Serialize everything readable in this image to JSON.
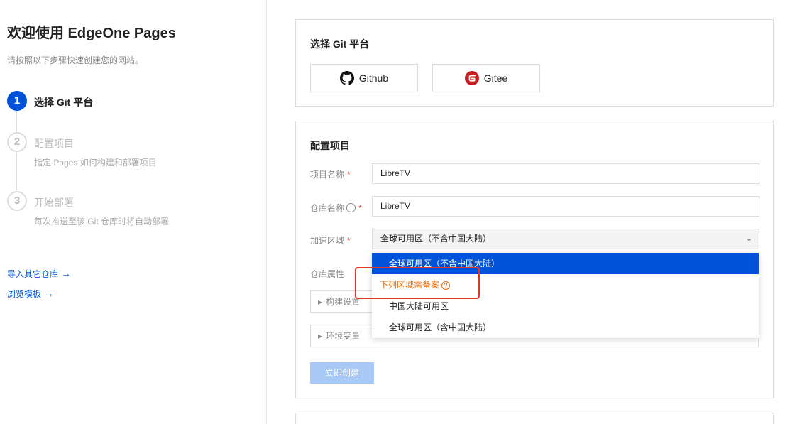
{
  "sidebar": {
    "title": "欢迎使用 EdgeOne Pages",
    "subtitle": "请按照以下步骤快速创建您的网站。",
    "steps": [
      {
        "num": "1",
        "title": "选择 Git 平台",
        "desc": ""
      },
      {
        "num": "2",
        "title": "配置项目",
        "desc": "指定 Pages 如何构建和部署项目"
      },
      {
        "num": "3",
        "title": "开始部署",
        "desc": "每次推送至该 Git 仓库时将自动部署"
      }
    ],
    "links": [
      {
        "label": "导入其它仓库",
        "arrow": "→"
      },
      {
        "label": "浏览模板",
        "arrow": "→"
      }
    ]
  },
  "git_platform": {
    "title": "选择 Git 平台",
    "options": [
      {
        "label": "Github",
        "icon": "github-icon"
      },
      {
        "label": "Gitee",
        "icon": "gitee-icon"
      }
    ]
  },
  "config": {
    "title": "配置项目",
    "project_name_label": "项目名称",
    "project_name_value": "LibreTV",
    "repo_name_label": "仓库名称",
    "repo_name_value": "LibreTV",
    "region_label": "加速区域",
    "region_value": "全球可用区（不含中国大陆）",
    "repo_attr_label": "仓库属性",
    "build_settings": "构建设置",
    "env_vars": "环境变量",
    "create_button": "立即创建",
    "required_mark": "*",
    "info_mark": "i"
  },
  "region_dropdown": {
    "selected": "全球可用区（不含中国大陆）",
    "group_label": "下列区域需备案",
    "group_help": "?",
    "items": [
      "中国大陆可用区",
      "全球可用区（含中国大陆）"
    ]
  },
  "colors": {
    "primary": "#0052d9",
    "warning": "#e56c0a",
    "highlight": "#e0392a",
    "gitee": "#c71d23"
  }
}
